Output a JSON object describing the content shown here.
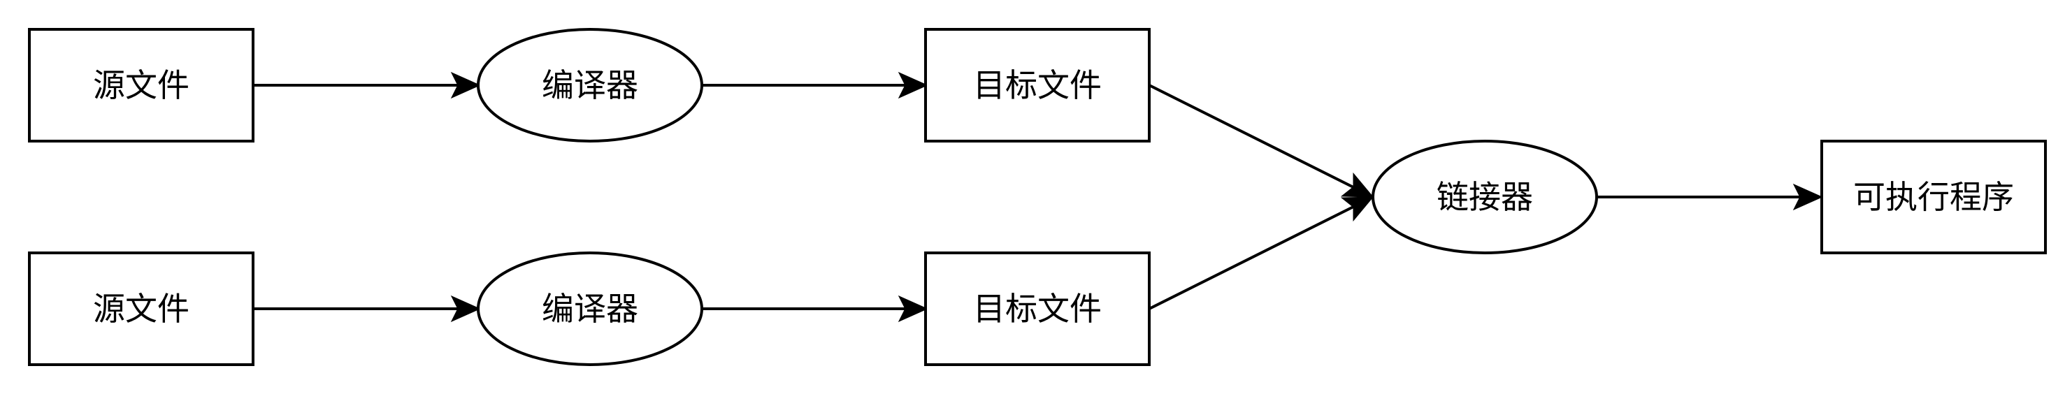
{
  "nodes": [
    {
      "id": "src1",
      "shape": "rect",
      "label": "源文件"
    },
    {
      "id": "cc1",
      "shape": "ellipse",
      "label": "编译器"
    },
    {
      "id": "obj1",
      "shape": "rect",
      "label": "目标文件"
    },
    {
      "id": "src2",
      "shape": "rect",
      "label": "源文件"
    },
    {
      "id": "cc2",
      "shape": "ellipse",
      "label": "编译器"
    },
    {
      "id": "obj2",
      "shape": "rect",
      "label": "目标文件"
    },
    {
      "id": "linker",
      "shape": "ellipse",
      "label": "链接器"
    },
    {
      "id": "exe",
      "shape": "rect",
      "label": "可执行程序"
    }
  ],
  "edges": [
    {
      "from": "src1",
      "to": "cc1"
    },
    {
      "from": "cc1",
      "to": "obj1"
    },
    {
      "from": "obj1",
      "to": "linker"
    },
    {
      "from": "src2",
      "to": "cc2"
    },
    {
      "from": "cc2",
      "to": "obj2"
    },
    {
      "from": "obj2",
      "to": "linker"
    },
    {
      "from": "linker",
      "to": "exe"
    }
  ],
  "colors": {
    "stroke": "#000000",
    "fill": "#ffffff",
    "text": "#000000"
  }
}
